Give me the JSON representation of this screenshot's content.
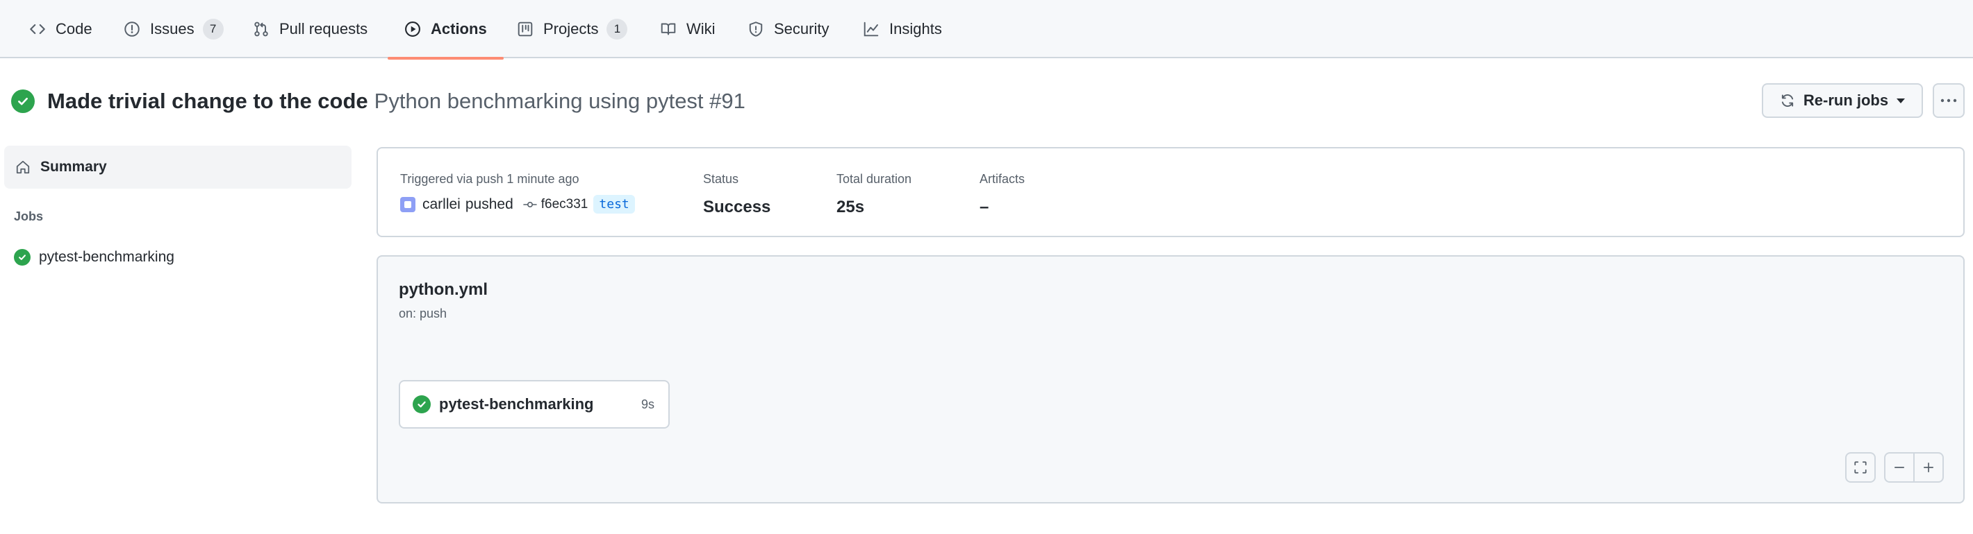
{
  "nav": {
    "tabs": [
      {
        "label": "Code",
        "icon": "code-icon"
      },
      {
        "label": "Issues",
        "count": "7",
        "icon": "issue-opened-icon"
      },
      {
        "label": "Pull requests",
        "icon": "git-pull-request-icon"
      },
      {
        "label": "Actions",
        "icon": "play-icon",
        "active": true
      },
      {
        "label": "Projects",
        "count": "1",
        "icon": "project-icon"
      },
      {
        "label": "Wiki",
        "icon": "book-icon"
      },
      {
        "label": "Security",
        "icon": "shield-icon"
      },
      {
        "label": "Insights",
        "icon": "graph-icon"
      }
    ],
    "active_color": "#fd8c73"
  },
  "run": {
    "commit_message": "Made trivial change to the code",
    "workflow_and_number": "Python benchmarking using pytest #91",
    "status_icon": "check-circle-fill-icon",
    "success_color": "#2da44e"
  },
  "toolbar": {
    "rerun_label": "Re-run jobs",
    "rerun_icon": "sync-icon",
    "more_icon": "kebab-horizontal-icon"
  },
  "sidebar": {
    "summary_label": "Summary",
    "summary_icon": "home-icon",
    "jobs_heading": "Jobs",
    "jobs": [
      {
        "label": "pytest-benchmarking",
        "status_icon": "check-circle-fill-icon"
      }
    ]
  },
  "summary": {
    "triggered_label": "Triggered via push 1 minute ago",
    "actor": "carllei",
    "action": "pushed",
    "commit_sha": "f6ec331",
    "branch": "test",
    "status_label": "Status",
    "status_value": "Success",
    "duration_label": "Total duration",
    "duration_value": "25s",
    "artifacts_label": "Artifacts",
    "artifacts_value": "–"
  },
  "graph": {
    "workflow_file": "python.yml",
    "trigger": "on: push",
    "job": {
      "name": "pytest-benchmarking",
      "duration": "9s"
    },
    "controls": [
      "screen-full-icon",
      "zoom-out-icon",
      "zoom-in-icon"
    ]
  }
}
